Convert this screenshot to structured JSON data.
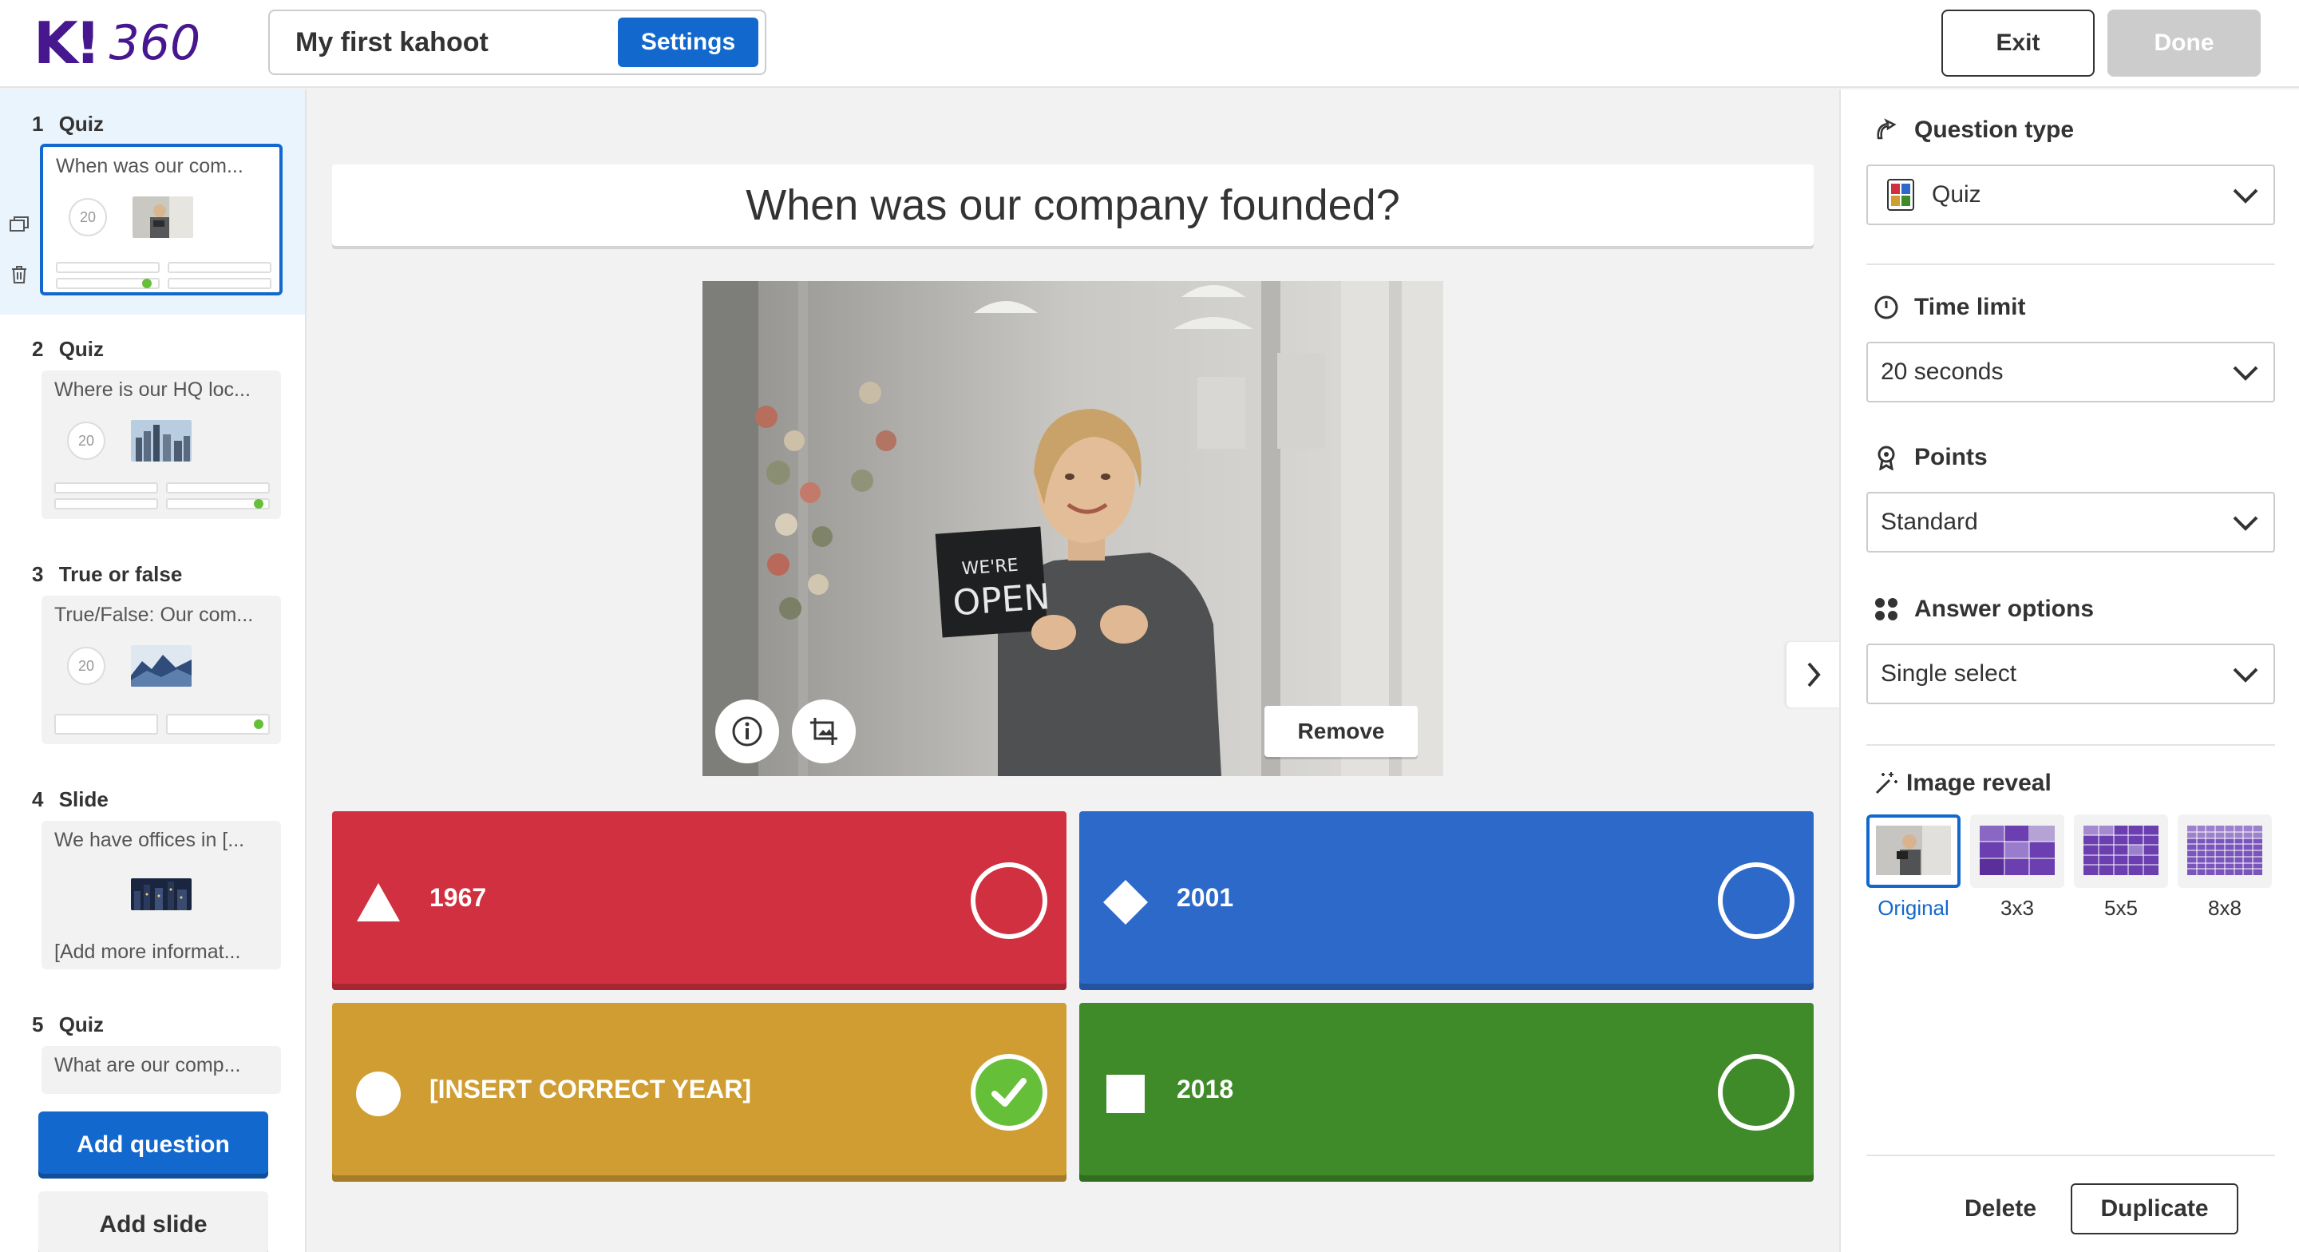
{
  "app": {
    "logo_k": "K!",
    "logo_360": "360"
  },
  "header": {
    "kahoot_title": "My first kahoot",
    "settings_label": "Settings",
    "exit_label": "Exit",
    "done_label": "Done"
  },
  "sidebar": {
    "items": [
      {
        "number": "1",
        "type": "Quiz",
        "title": "When was our com...",
        "time": "20"
      },
      {
        "number": "2",
        "type": "Quiz",
        "title": "Where is our HQ loc...",
        "time": "20"
      },
      {
        "number": "3",
        "type": "True or false",
        "title": "True/False: Our com...",
        "time": "20"
      },
      {
        "number": "4",
        "type": "Slide",
        "title": "We have offices in [...",
        "footer": "[Add more informat..."
      },
      {
        "number": "5",
        "type": "Quiz",
        "title": "What are our comp..."
      }
    ],
    "add_question_label": "Add question",
    "add_slide_label": "Add slide"
  },
  "editor": {
    "question": "When was our company founded?",
    "image_sign_line1": "WE'RE",
    "image_sign_line2": "OPEN",
    "remove_label": "Remove",
    "answers": [
      {
        "text": "1967",
        "color": "#d0303f",
        "shape": "triangle",
        "correct": false
      },
      {
        "text": "2001",
        "color": "#2d69c9",
        "shape": "diamond",
        "correct": false
      },
      {
        "text": "[INSERT CORRECT YEAR]",
        "color": "#cf9d32",
        "shape": "circle",
        "correct": true
      },
      {
        "text": "2018",
        "color": "#3f8a29",
        "shape": "square",
        "correct": false
      }
    ]
  },
  "panel": {
    "question_type_label": "Question type",
    "question_type_value": "Quiz",
    "time_limit_label": "Time limit",
    "time_limit_value": "20 seconds",
    "points_label": "Points",
    "points_value": "Standard",
    "answer_options_label": "Answer options",
    "answer_options_value": "Single select",
    "image_reveal_label": "Image reveal",
    "reveal_options": [
      "Original",
      "3x3",
      "5x5",
      "8x8"
    ],
    "reveal_selected": "Original",
    "delete_label": "Delete",
    "duplicate_label": "Duplicate"
  },
  "colors": {
    "brand": "#46178f",
    "accent_blue": "#1368ce",
    "correct_green": "#66bf39"
  }
}
